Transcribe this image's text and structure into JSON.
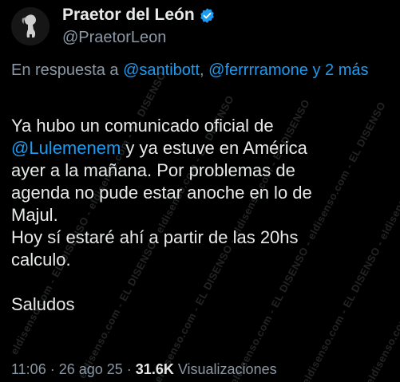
{
  "author": {
    "display_name": "Praetor del León",
    "handle": "@PraetorLeon",
    "avatar_icon": "lion-figure-avatar",
    "verified_icon": "verified-badge-icon",
    "verified_color": "#1d9bf0"
  },
  "reply": {
    "prefix": "En respuesta a ",
    "mention_1": "@santibott",
    "separator": ", ",
    "mention_2": "@ferrrramone",
    "suffix": " y 2 más"
  },
  "body": {
    "line_1": "Ya hubo un comunicado oficial de",
    "mention": "@Lulemenem",
    "line_2_rest": " y ya estuve en América",
    "line_3": "ayer a la mañana. Por problemas de",
    "line_4": "agenda no pude estar anoche en lo de",
    "line_5": "Majul.",
    "line_6": "Hoy sí estaré ahí a partir de las 20hs",
    "line_7": "calculo.",
    "line_9": "Saludos"
  },
  "meta": {
    "time": "11:06",
    "dot": " · ",
    "date": "26 ago 25",
    "views_count": "31.6K",
    "views_label": " Visualizaciones"
  },
  "watermark": {
    "text": "eldisenso.com - EL DISENSO - eldisenso.com - EL DISENSO"
  },
  "colors": {
    "background": "#000000",
    "text": "#e7e9ea",
    "muted": "#8b98a5",
    "link": "#1d9bf0"
  }
}
